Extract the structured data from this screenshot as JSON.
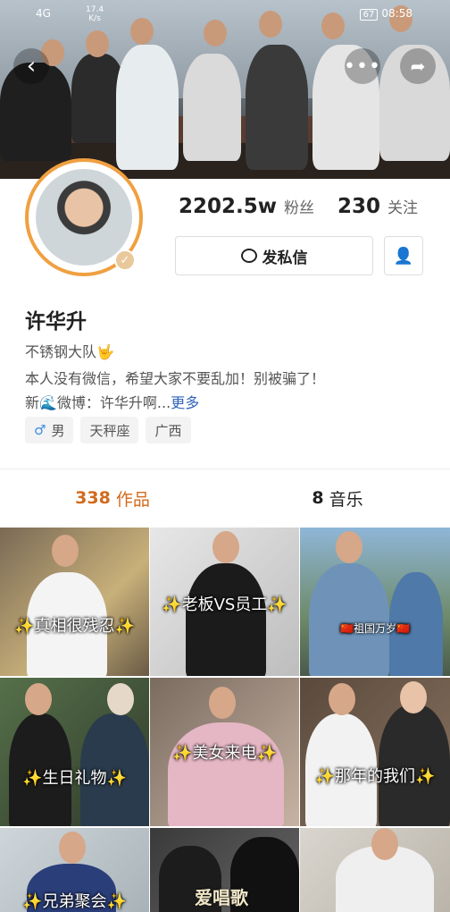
{
  "status_bar": {
    "signal": "4G",
    "net_speed_value": "17.4",
    "net_speed_unit": "K/s",
    "battery": "67",
    "time": "08:58"
  },
  "header": {
    "back_icon": "back-arrow-icon",
    "more_icon": "more-dots-icon",
    "share_icon": "share-icon"
  },
  "profile": {
    "followers_count": "2202.5w",
    "followers_label": "粉丝",
    "following_count": "230",
    "following_label": "关注",
    "message_button": "发私信",
    "name": "许华升",
    "bio_line1": "不锈钢大队🤟",
    "bio_line2": "本人没有微信，希望大家不要乱加！别被骗了！",
    "bio_line3_prefix": "新🌊微博：许华升啊...",
    "bio_more": "更多",
    "tags": [
      "男",
      "天秤座",
      "广西"
    ]
  },
  "tabs": {
    "works_count": "338",
    "works_label": "作品",
    "music_count": "8",
    "music_label": "音乐"
  },
  "videos": [
    {
      "caption": "✨真相很残忍✨"
    },
    {
      "caption": "✨老板VS员工✨"
    },
    {
      "caption": "🇨🇳祖国万岁🇨🇳"
    },
    {
      "caption": "✨生日礼物✨"
    },
    {
      "caption": "✨美女来电✨"
    },
    {
      "caption": "✨那年的我们✨"
    },
    {
      "caption": "✨兄弟聚会✨"
    },
    {
      "caption": ""
    },
    {
      "caption": ""
    }
  ],
  "watermark": "爱唱歌",
  "colors": {
    "accent_orange": "#d36a1b",
    "link_blue": "#2f63b8",
    "avatar_ring": "#f0a040"
  }
}
